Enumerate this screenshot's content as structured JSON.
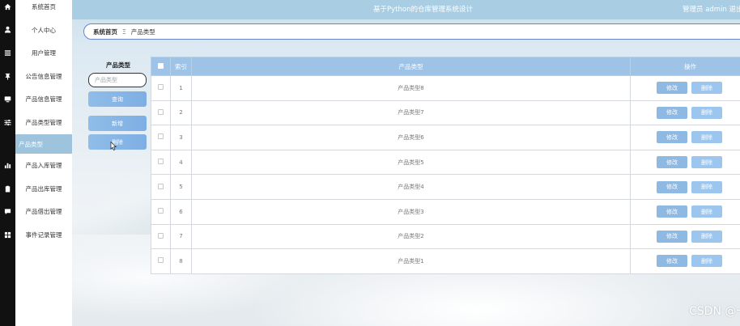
{
  "header": {
    "title": "基于Python的仓库管理系统设计",
    "user": "管理员 admin  退出"
  },
  "menu": [
    {
      "label": "系统首页",
      "icon": "home-icon"
    },
    {
      "label": "个人中心",
      "icon": "user-icon"
    },
    {
      "label": "用户管理",
      "icon": "list-icon"
    },
    {
      "label": "公告信息管理",
      "icon": "pin-icon"
    },
    {
      "label": "产品信息管理",
      "icon": "monitor-icon"
    },
    {
      "label": "产品类型管理",
      "icon": "sliders-icon"
    },
    {
      "label": "产品类型",
      "icon": "",
      "sub": true
    },
    {
      "label": "产品入库管理",
      "icon": "bar-chart-icon"
    },
    {
      "label": "产品出库管理",
      "icon": "clipboard-icon"
    },
    {
      "label": "产品借出管理",
      "icon": "chat-icon"
    },
    {
      "label": "事件记录管理",
      "icon": "grid-icon"
    }
  ],
  "breadcrumb": {
    "home": "系统首页",
    "separator": "Ξ",
    "current": "产品类型"
  },
  "search": {
    "label": "产品类型",
    "placeholder": "产品类型",
    "query_label": "查询",
    "add_label": "新增",
    "delete_label": "删除"
  },
  "table": {
    "columns": {
      "index": "索引",
      "type": "产品类型",
      "actions": "操作"
    },
    "rows": [
      {
        "index": "1",
        "type": "产品类型8"
      },
      {
        "index": "2",
        "type": "产品类型7"
      },
      {
        "index": "3",
        "type": "产品类型6"
      },
      {
        "index": "4",
        "type": "产品类型5"
      },
      {
        "index": "5",
        "type": "产品类型4"
      },
      {
        "index": "6",
        "type": "产品类型3"
      },
      {
        "index": "7",
        "type": "产品类型2"
      },
      {
        "index": "8",
        "type": "产品类型1"
      }
    ],
    "edit_label": "修改",
    "delete_label": "删除"
  },
  "watermark": "CSDN @一点毕设",
  "colors": {
    "header": "#a9cde2",
    "button": "#8db9e2",
    "rail": "#111111",
    "active_menu": "#9ec3dd"
  }
}
